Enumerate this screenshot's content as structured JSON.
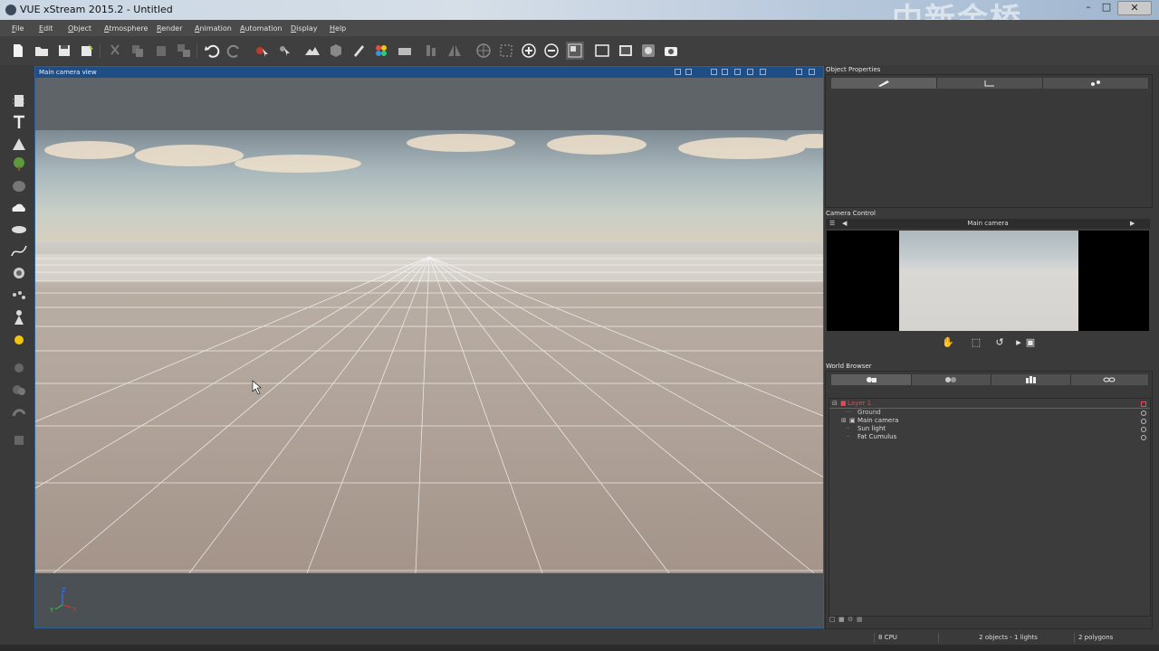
{
  "window": {
    "title": "VUE xStream 2015.2 - Untitled",
    "watermark": "中新金桥"
  },
  "menu": [
    "File",
    "Edit",
    "Object",
    "Atmosphere",
    "Render",
    "Animation",
    "Automation",
    "Display",
    "Help"
  ],
  "toolbar": {
    "icons": [
      "new-icon",
      "open-icon",
      "save-icon",
      "save-as-icon",
      "cut-icon",
      "copy-icon",
      "paste-icon",
      "duplicate-icon",
      "undo-icon",
      "redo-icon",
      "select-icon",
      "select-move-icon",
      "terrain-icon",
      "cube-icon",
      "drop-icon",
      "materials-icon",
      "film-icon",
      "align-icon",
      "symmetry-icon",
      "globe-icon",
      "frame-icon",
      "zoom-in-icon",
      "zoom-out-icon",
      "view-icon",
      "render-area-icon",
      "render-icon",
      "render-options-icon",
      "camera-icon"
    ]
  },
  "left_tools": [
    "dots-icon",
    "cylinder-icon",
    "text-icon",
    "plant-icon",
    "tree-icon",
    "rock-icon",
    "cloud-icon",
    "planet-icon",
    "curve-icon",
    "ecosystem-icon",
    "particles-icon",
    "character-icon",
    "light-icon",
    "group-icon",
    "boolean-icon",
    "metablob-icon",
    "bottom-icon"
  ],
  "viewport": {
    "title": "Main camera view",
    "axes": {
      "z": "Z",
      "y": "Y",
      "x": "X"
    }
  },
  "object_properties": {
    "title": "Object Properties",
    "tabs": [
      "brush-icon",
      "graph-icon",
      "link-icon"
    ]
  },
  "camera_control": {
    "title": "Camera Control",
    "camera_name": "Main camera"
  },
  "world_browser": {
    "title": "World Browser",
    "tabs": [
      "objects-icon",
      "materials-icon",
      "library-icon",
      "links-icon"
    ],
    "items": [
      {
        "label": "Layer 1",
        "kind": "layer"
      },
      {
        "label": "Ground",
        "kind": "object"
      },
      {
        "label": "Main camera",
        "kind": "camera"
      },
      {
        "label": "Sun light",
        "kind": "light"
      },
      {
        "label": "Fat Cumulus",
        "kind": "cloud"
      }
    ]
  },
  "status": {
    "cpu": "8 CPU",
    "objects": "2 objects - 1 lights",
    "polygons": "2 polygons"
  },
  "colors": {
    "accent": "#1f4e86",
    "layer_text": "#e04c5a",
    "bg": "#3a3a3a"
  }
}
